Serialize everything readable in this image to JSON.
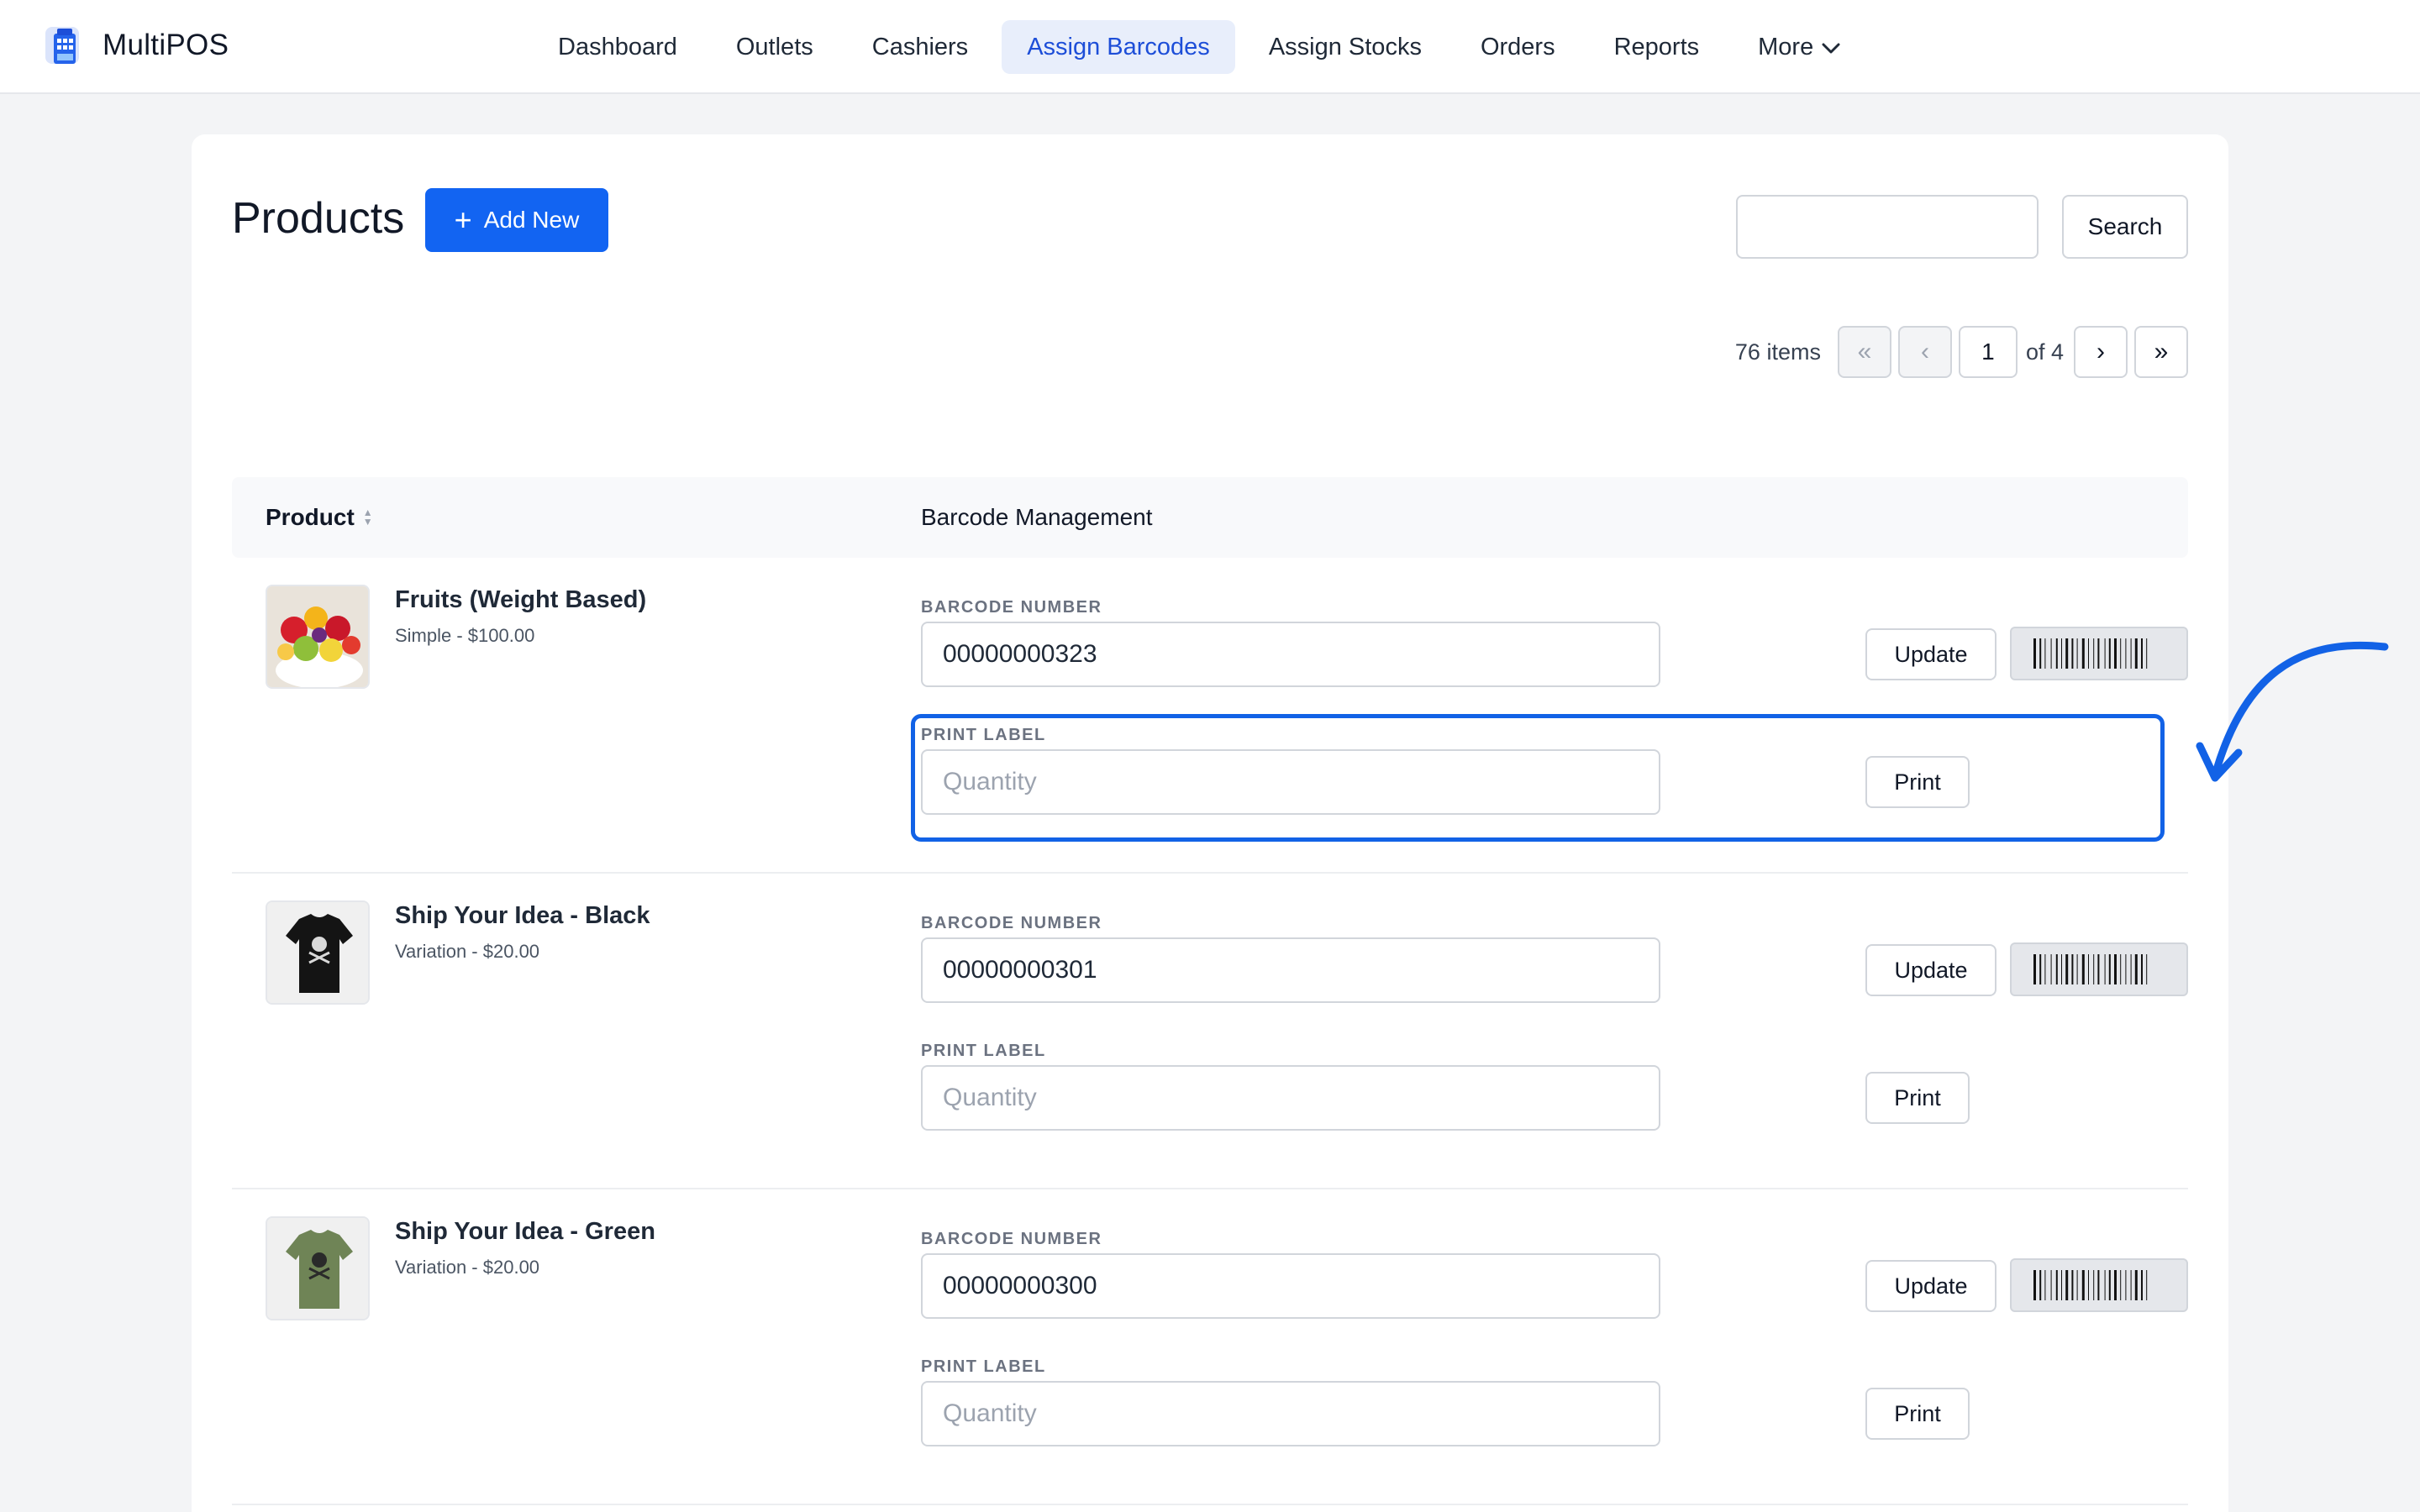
{
  "app": {
    "name": "MultiPOS"
  },
  "nav": {
    "items": [
      {
        "label": "Dashboard",
        "active": false
      },
      {
        "label": "Outlets",
        "active": false
      },
      {
        "label": "Cashiers",
        "active": false
      },
      {
        "label": "Assign Barcodes",
        "active": true
      },
      {
        "label": "Assign Stocks",
        "active": false
      },
      {
        "label": "Orders",
        "active": false
      },
      {
        "label": "Reports",
        "active": false
      },
      {
        "label": "More",
        "active": false
      }
    ]
  },
  "page": {
    "title": "Products",
    "add_label": "Add New",
    "search": {
      "value": "",
      "button_label": "Search"
    }
  },
  "pagination": {
    "count_text": "76 items",
    "first": "«",
    "prev": "‹",
    "current_page": "1",
    "of_text": "of 4",
    "next": "›",
    "last": "»"
  },
  "table": {
    "col_product": "Product",
    "col_barcode": "Barcode Management",
    "barcode_label": "BARCODE NUMBER",
    "print_label": "PRINT LABEL",
    "update_label": "Update",
    "print_button": "Print",
    "quantity_placeholder": "Quantity",
    "rows": [
      {
        "name": "Fruits (Weight Based)",
        "meta": "Simple - $100.00",
        "barcode": "00000000323",
        "image": "fruit-bowl"
      },
      {
        "name": "Ship Your Idea - Black",
        "meta": "Variation - $20.00",
        "barcode": "00000000301",
        "image": "black-tshirt"
      },
      {
        "name": "Ship Your Idea - Green",
        "meta": "Variation - $20.00",
        "barcode": "00000000300",
        "image": "green-tshirt"
      }
    ]
  },
  "colors": {
    "accent": "#1264f2",
    "highlight": "#1262e6",
    "nav_active_bg": "#e8eefb"
  }
}
